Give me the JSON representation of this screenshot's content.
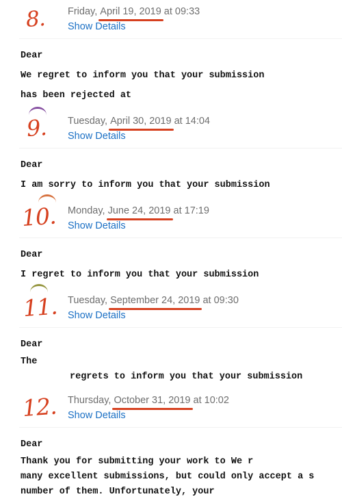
{
  "accent": {
    "handwriting_red": "#d6401f",
    "link_blue": "#1a6fc4",
    "date_gray": "#6e6e6e",
    "rule_gray": "#f2f2f2",
    "arc_purple": "#7b3f98",
    "arc_orange": "#d2622a",
    "arc_olive": "#8a8a2a"
  },
  "details_label": "Show Details",
  "entries": [
    {
      "numeral": "8.",
      "arc": null,
      "date_prefix": "Friday, ",
      "date_underlined": "April 19, 2019",
      "date_suffix": " at 09:33",
      "body_lines": [
        "Dear",
        "We regret to inform you that your submission",
        "has been rejected at"
      ]
    },
    {
      "numeral": "9.",
      "arc": "purple",
      "date_prefix": "Tuesday, ",
      "date_underlined": "April 30, 2019",
      "date_suffix": " at 14:04",
      "body_lines": [
        "Dear",
        "I am sorry to inform you that your submission"
      ]
    },
    {
      "numeral": "10.",
      "arc": "orange",
      "date_prefix": "Monday, ",
      "date_underlined": "June 24, 2019",
      "date_suffix": " at 17:19",
      "body_lines": [
        "Dear",
        "I regret to inform you that your submission"
      ]
    },
    {
      "numeral": "11.",
      "arc": "olive",
      "date_prefix": "Tuesday, ",
      "date_underlined": "September 24, 2019",
      "date_suffix": " at 09:30",
      "body_lines": [
        "Dear",
        "The",
        "regrets to inform you that your submission"
      ]
    },
    {
      "numeral": "12.",
      "arc": null,
      "date_prefix": "Thursday, ",
      "date_underlined": "October 31, 2019",
      "date_suffix": " at 10:02",
      "body_lines": [
        "Dear",
        "Thank you for submitting your work to               We r",
        "many excellent submissions, but could only accept a s",
        "number of them. Unfortunately, your"
      ]
    }
  ]
}
